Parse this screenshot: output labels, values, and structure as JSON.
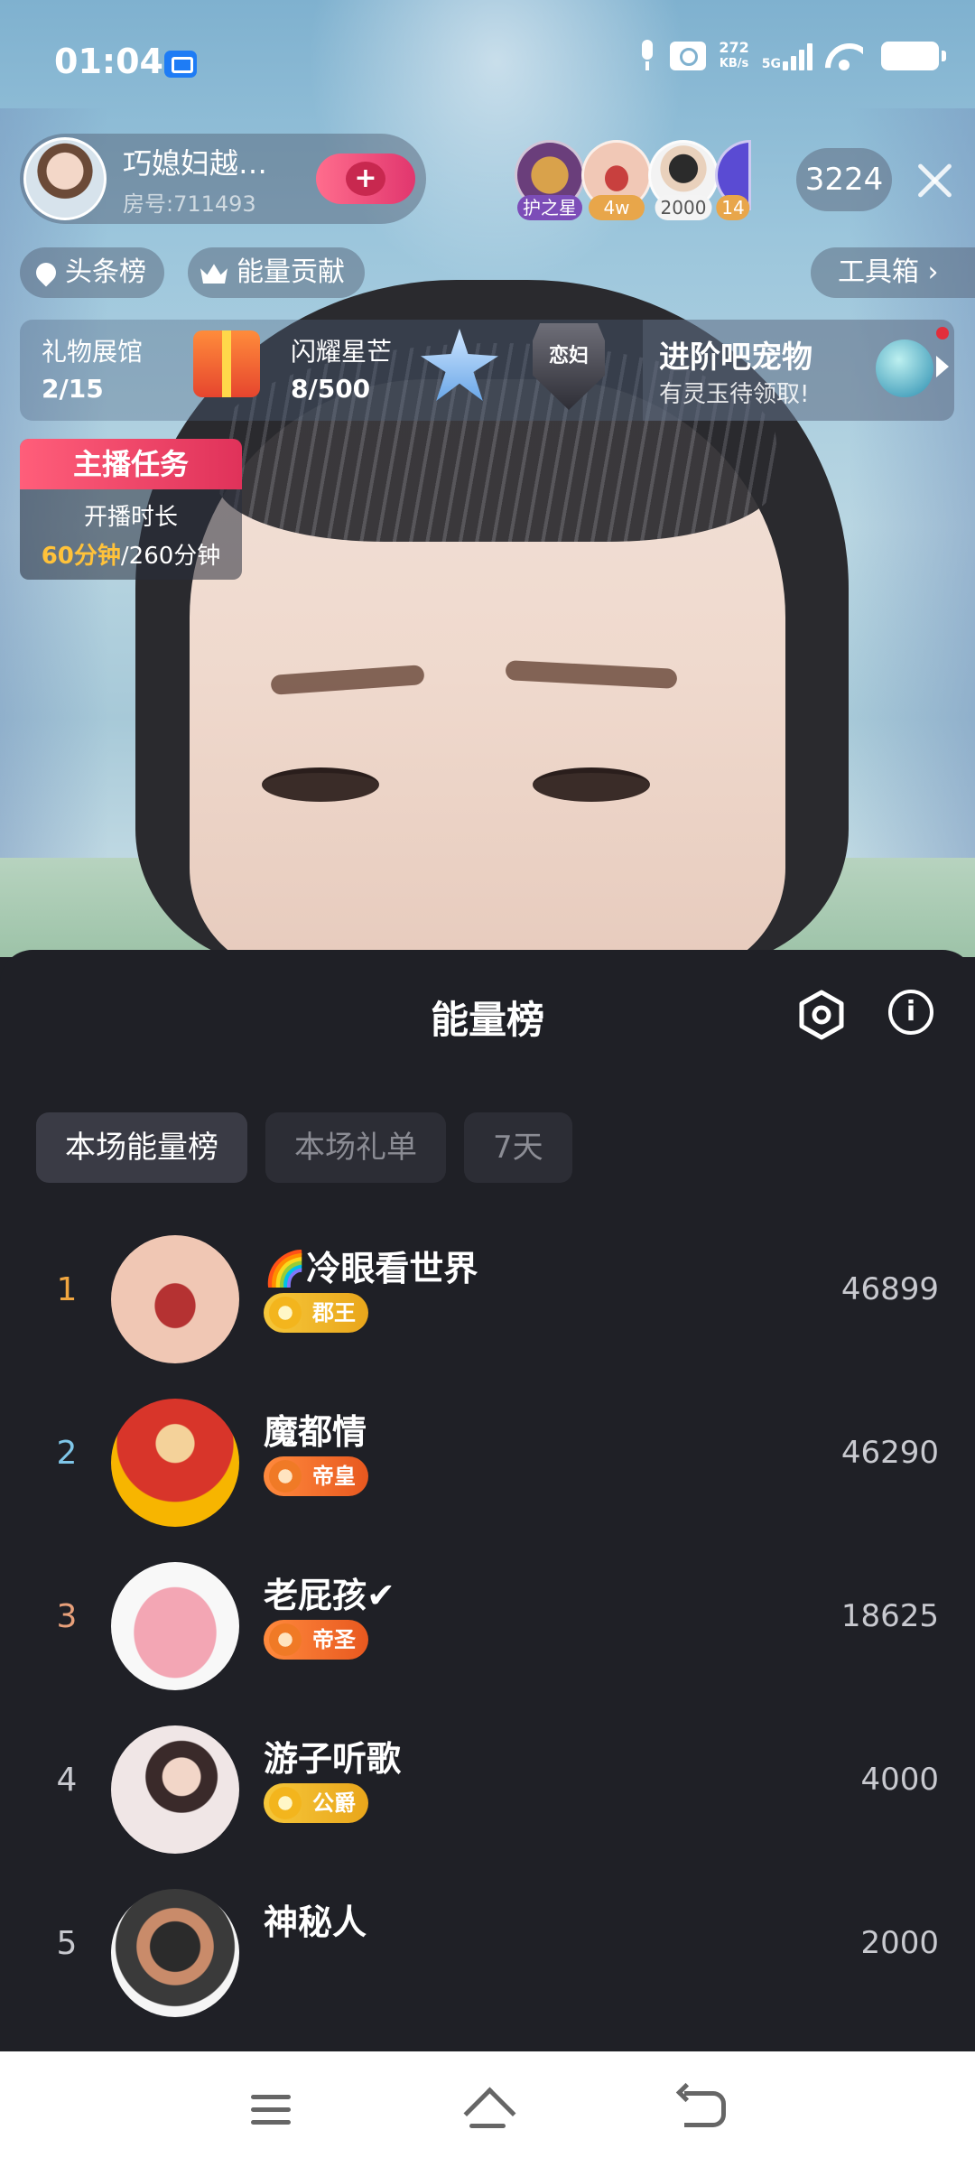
{
  "status_bar": {
    "time": "01:04",
    "net_speed": "272",
    "net_unit": "KB/s",
    "network_type": "5G"
  },
  "host": {
    "name": "巧媳妇越…",
    "room": "房号:711493",
    "follow_label": "+"
  },
  "viewers": [
    {
      "tag": "护之星",
      "icon": "gold-helmet-avatar"
    },
    {
      "tag": "4w",
      "icon": "lips-avatar"
    },
    {
      "tag": "2000",
      "icon": "mystery-person-avatar"
    },
    {
      "tag": "14",
      "icon": "wizard-hat-avatar"
    }
  ],
  "viewer_count": "3224",
  "chips": {
    "headline": "头条榜",
    "energy_contribution": "能量贡献",
    "toolbox": "工具箱 ›"
  },
  "banner": {
    "gift_hall_label": "礼物展馆",
    "gift_hall_value": "2/15",
    "star_label": "闪耀星芒",
    "star_value": "8/500",
    "shield_text": "恋妇",
    "promo_title": "进阶吧宠物",
    "promo_sub": "有灵玉待领取!"
  },
  "task": {
    "title": "主播任务",
    "label": "开播时长",
    "done": "60分钟",
    "total": "/260分钟"
  },
  "sheet": {
    "title": "能量榜",
    "tabs": [
      {
        "label": "本场能量榜",
        "active": true
      },
      {
        "label": "本场礼单",
        "active": false
      },
      {
        "label": "7天",
        "active": false
      }
    ],
    "ranks": [
      {
        "rank": "1",
        "rank_color": "#f0a640",
        "name": "🌈冷眼看世界",
        "badge": "郡王",
        "badge_style": "gold",
        "score": "46899"
      },
      {
        "rank": "2",
        "rank_color": "#7fc6e8",
        "name": "魔都情",
        "badge": "帝皇",
        "badge_style": "orange",
        "score": "46290"
      },
      {
        "rank": "3",
        "rank_color": "#e8a07a",
        "name": "老屁孩✔",
        "badge": "帝圣",
        "badge_style": "orange",
        "score": "18625"
      },
      {
        "rank": "4",
        "rank_color": "#c8c9cf",
        "name": "游子听歌",
        "badge": "公爵",
        "badge_style": "gold",
        "score": "4000"
      },
      {
        "rank": "5",
        "rank_color": "#c8c9cf",
        "name": "神秘人",
        "badge": "",
        "badge_style": "",
        "score": "2000"
      }
    ]
  }
}
